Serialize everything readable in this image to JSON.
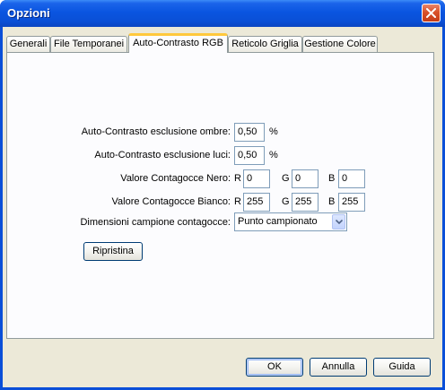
{
  "window": {
    "title": "Opzioni",
    "close_icon": "close-icon"
  },
  "tabs": [
    {
      "label": "Generali",
      "active": false
    },
    {
      "label": "File Temporanei",
      "active": false
    },
    {
      "label": "Auto-Contrasto RGB",
      "active": true
    },
    {
      "label": "Reticolo Griglia",
      "active": false
    },
    {
      "label": "Gestione Colore",
      "active": false
    }
  ],
  "form": {
    "shadow_clip_label": "Auto-Contrasto esclusione ombre:",
    "shadow_clip_value": "0,50",
    "highlight_clip_label": "Auto-Contrasto esclusione luci:",
    "highlight_clip_value": "0,50",
    "percent_unit": "%",
    "black_point_label": "Valore Contagocce Nero:",
    "black_point": {
      "r": "0",
      "g": "0",
      "b": "0"
    },
    "white_point_label": "Valore Contagocce Bianco:",
    "white_point": {
      "r": "255",
      "g": "255",
      "b": "255"
    },
    "channel_r": "R",
    "channel_g": "G",
    "channel_b": "B",
    "sample_size_label": "Dimensioni campione contagocce:",
    "sample_size_value": "Punto campionato",
    "reset_button": "Ripristina"
  },
  "footer": {
    "ok_button": "OK",
    "cancel_button": "Annulla",
    "help_button": "Guida"
  },
  "colors": {
    "titlebar": "#0a55e0",
    "dialog_background": "#ece9d8",
    "active_tab_highlight": "#ffc83c"
  }
}
